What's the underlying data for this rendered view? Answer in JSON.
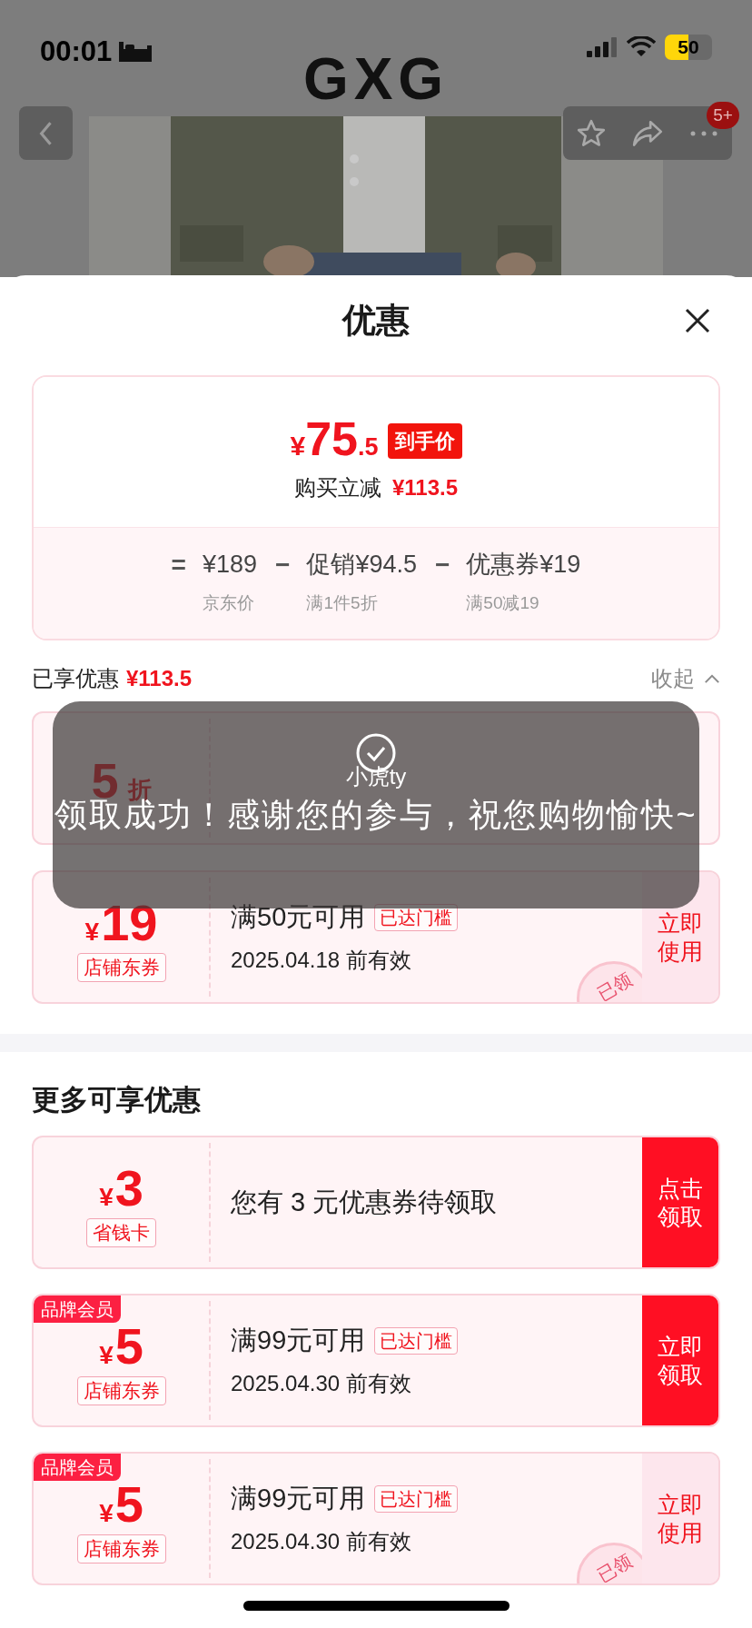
{
  "status_bar": {
    "time": "00:01",
    "battery": "50"
  },
  "product_header": {
    "logo": "GXG",
    "badge": "5+"
  },
  "sheet": {
    "title": "优惠"
  },
  "price_card": {
    "currency": "¥",
    "price_int": "75",
    "price_dec": ".5",
    "price_tag": "到手价",
    "saving_label": "购买立减",
    "saving_amount": "¥113.5",
    "formula": [
      {
        "operator": "=",
        "amount": "¥189",
        "note": "京东价"
      },
      {
        "operator": "−",
        "label": "促销",
        "amount": "¥94.5",
        "note": "满1件5折"
      },
      {
        "operator": "−",
        "label": "优惠券",
        "amount": "¥19",
        "note": "满50减19"
      }
    ]
  },
  "enjoyed": {
    "label": "已享优惠",
    "amount": "¥113.5",
    "toggle": "收起",
    "expanded": true
  },
  "enjoyed_coupons": [
    {
      "kind": "discount",
      "value": "5",
      "unit": "折"
    },
    {
      "kind": "cash",
      "currency": "¥",
      "value": "19",
      "tag": "店铺东券",
      "title": "满50元可用",
      "badge": "已达门槛",
      "validity": "2025.04.18 前有效",
      "action": {
        "label": "立即使用",
        "kind": "use"
      },
      "stamp": "已领"
    }
  ],
  "more": {
    "title": "更多可享优惠",
    "coupons": [
      {
        "kind": "cash",
        "currency": "¥",
        "value": "3",
        "tag": "省钱卡",
        "title": "您有 3 元优惠券待领取",
        "action": {
          "label": "点击领取",
          "kind": "claim"
        }
      },
      {
        "kind": "cash",
        "member_tag": "品牌会员",
        "currency": "¥",
        "value": "5",
        "tag": "店铺东券",
        "title": "满99元可用",
        "badge": "已达门槛",
        "validity": "2025.04.30 前有效",
        "action": {
          "label": "立即领取",
          "kind": "claim"
        }
      },
      {
        "kind": "cash",
        "member_tag": "品牌会员",
        "currency": "¥",
        "value": "5",
        "tag": "店铺东券",
        "title": "满99元可用",
        "badge": "已达门槛",
        "validity": "2025.04.30 前有效",
        "action": {
          "label": "立即使用",
          "kind": "use"
        },
        "stamp": "已领"
      }
    ]
  },
  "toast": {
    "user": "小虎ty",
    "message": "领取成功！感谢您的参与，祝您购物愉快~"
  }
}
